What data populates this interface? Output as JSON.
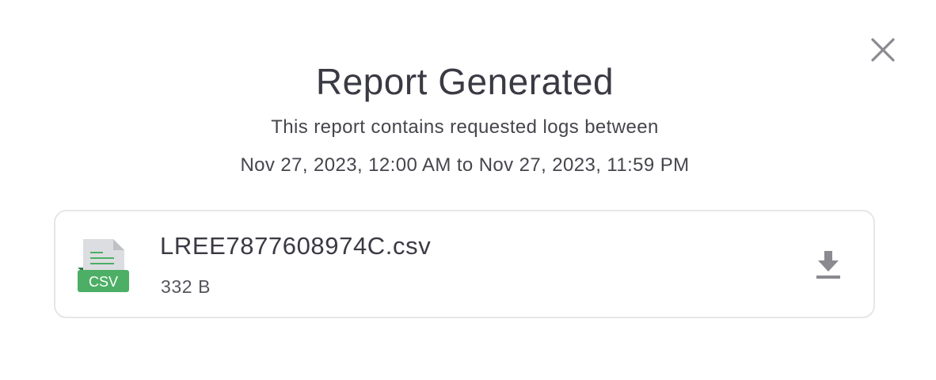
{
  "dialog": {
    "title": "Report Generated",
    "subtitle_line1": "This report contains requested logs between",
    "subtitle_line2": "Nov 27, 2023, 12:00 AM to Nov 27, 2023, 11:59 PM",
    "close_icon": "close-icon"
  },
  "file": {
    "icon": "csv-file-icon",
    "type_label": "CSV",
    "name": "LREE7877608974C.csv",
    "size": "332 B",
    "download_icon": "download-icon"
  },
  "colors": {
    "csv_green": "#4caf65",
    "text_dark": "#3a3a44",
    "icon_gray": "#8a8a90",
    "border": "#e6e6e9"
  }
}
